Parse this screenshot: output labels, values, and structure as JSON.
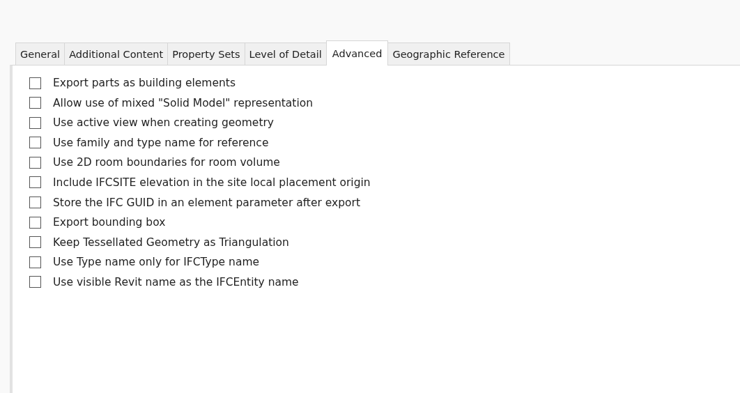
{
  "tabs": [
    {
      "label": "General",
      "selected": false
    },
    {
      "label": "Additional Content",
      "selected": false
    },
    {
      "label": "Property Sets",
      "selected": false
    },
    {
      "label": "Level of Detail",
      "selected": false
    },
    {
      "label": "Advanced",
      "selected": true
    },
    {
      "label": "Geographic Reference",
      "selected": false
    }
  ],
  "options": [
    {
      "label": "Export parts as building elements",
      "checked": false
    },
    {
      "label": "Allow use of mixed \"Solid Model\" representation",
      "checked": false
    },
    {
      "label": "Use active view when creating geometry",
      "checked": false
    },
    {
      "label": "Use family and type name for reference",
      "checked": false
    },
    {
      "label": "Use 2D room boundaries for room volume",
      "checked": false
    },
    {
      "label": "Include IFCSITE elevation in the site local placement origin",
      "checked": false
    },
    {
      "label": "Store the IFC GUID in an element parameter after export",
      "checked": false
    },
    {
      "label": "Export bounding box",
      "checked": false
    },
    {
      "label": "Keep Tessellated Geometry as Triangulation",
      "checked": false
    },
    {
      "label": "Use Type name only for IFCType name",
      "checked": false
    },
    {
      "label": "Use visible Revit name as the IFCEntity name",
      "checked": false
    }
  ]
}
